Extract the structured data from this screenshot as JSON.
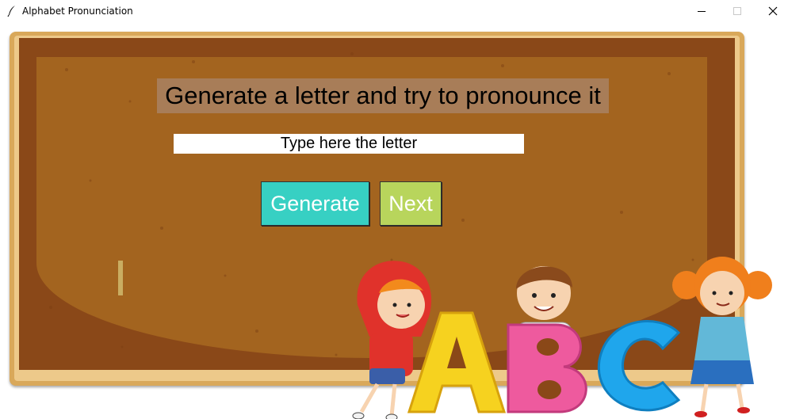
{
  "window": {
    "title": "Alphabet Pronunciation",
    "icon": "feather-icon",
    "controls": [
      "minimize-icon",
      "maximize-icon",
      "close-icon"
    ]
  },
  "main": {
    "heading": "Generate a letter and try to pronounce it",
    "letter_input": {
      "value": "Type here the letter"
    },
    "generate_label": "Generate",
    "next_label": "Next"
  },
  "illustration": {
    "letters": [
      "A",
      "B",
      "C"
    ],
    "description_icon": "kids-abc-illustration"
  },
  "colors": {
    "board": "#8a4818",
    "frame": "#d9a85a",
    "heading_bg": "#a87d58",
    "generate_button": "#37d0c3",
    "next_button": "#b8d55c"
  }
}
